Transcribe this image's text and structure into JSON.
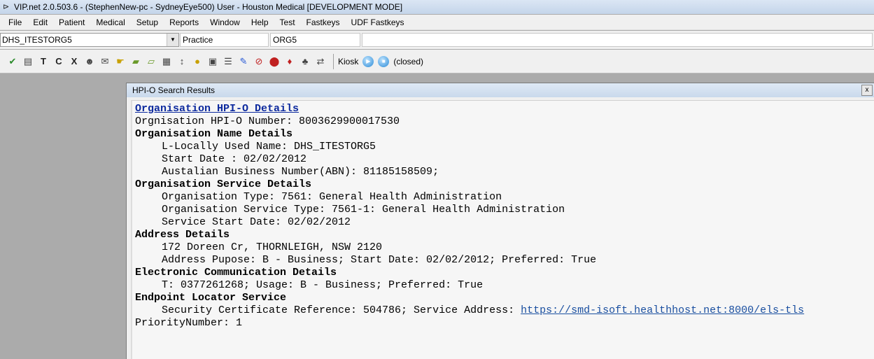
{
  "window": {
    "title": "VIP.net 2.0.503.6 - (StephenNew-pc - SydneyEye500)  User - Houston Medical [DEVELOPMENT MODE]",
    "app_icon": "⊳"
  },
  "menubar": {
    "items": [
      "File",
      "Edit",
      "Patient",
      "Medical",
      "Setup",
      "Reports",
      "Window",
      "Help",
      "Test",
      "Fastkeys",
      "UDF Fastkeys"
    ]
  },
  "selector": {
    "org_value": "DHS_ITESTORG5",
    "field1": "Practice",
    "field2": "ORG5",
    "field3": ""
  },
  "toolbar": {
    "icons": [
      "spellcheck-icon",
      "clipboard-icon",
      "t-icon",
      "c-icon",
      "x-icon",
      "doctor-icon",
      "mail-icon",
      "hand-icon",
      "tray-icon",
      "tray-down-icon",
      "document-icon",
      "sort-icon",
      "coin-icon",
      "calculator-icon",
      "list-icon",
      "pen-icon",
      "no-entry-icon",
      "stop-icon",
      "blood-drop-icon",
      "tree-icon",
      "car-icon"
    ],
    "kiosk_label": "Kiosk",
    "kiosk_status": "(closed)"
  },
  "dialog": {
    "title": "HPI-O Search Results",
    "close_label": "x",
    "lines": {
      "l0": "Organisation HPI-O Details ",
      "l1": "Orgnisation HPI-O Number: 8003629900017530",
      "l2": "Organisation Name Details",
      "l3": "L-Locally Used Name: DHS_ITESTORG5",
      "l4": "Start Date : 02/02/2012",
      "l5": "Austalian Business Number(ABN): 81185158509;",
      "l6": "Organisation Service Details",
      "l7": "Organisation Type: 7561: General Health Administration",
      "l8": "Organisation Service Type: 7561-1: General Health Administration",
      "l9": "Service Start Date: 02/02/2012",
      "l10": "Address Details",
      "l11": "172 Doreen Cr, THORNLEIGH, NSW 2120",
      "l12": "Address Pupose: B - Business; Start Date: 02/02/2012; Preferred: True",
      "l13": "Electronic Communication Details",
      "l14": "T: 0377261268; Usage: B - Business; Preferred: True",
      "l15": "Endpoint Locator Service",
      "l16_prefix": "Security Certificate Reference: 504786; Service Address: ",
      "l16_url": "https://smd-isoft.healthhost.net:8000/els-tls",
      "l17": "PriorityNumber: 1"
    }
  }
}
